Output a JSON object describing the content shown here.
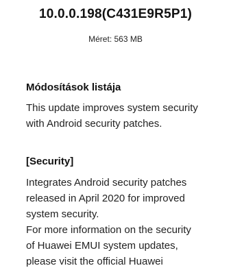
{
  "update": {
    "version": "10.0.0.198(C431E9R5P1)",
    "size_label": "Méret: 563 MB"
  },
  "changelog": {
    "heading": "Módosítások listája",
    "description_lines": [
      "This update improves system security",
      "with Android security patches."
    ]
  },
  "security": {
    "heading": "[Security]",
    "lines": [
      "Integrates Android security patches",
      "released in April 2020 for improved",
      "system security.",
      "For more information on the security",
      "of Huawei EMUI system updates,",
      "please visit the official Huawei"
    ]
  }
}
